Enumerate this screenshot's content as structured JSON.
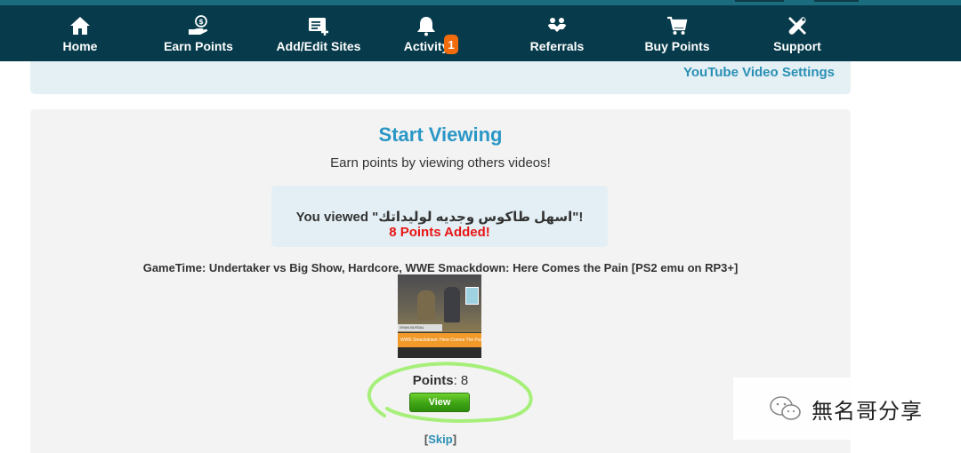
{
  "nav": {
    "items": [
      {
        "label": "Home",
        "icon": "home-icon"
      },
      {
        "label": "Earn Points",
        "icon": "earn-points-icon"
      },
      {
        "label": "Add/Edit Sites",
        "icon": "add-edit-sites-icon"
      },
      {
        "label": "Activity",
        "icon": "bell-icon",
        "badge": "1"
      },
      {
        "label": "Referrals",
        "icon": "referrals-icon"
      },
      {
        "label": "Buy Points",
        "icon": "cart-icon"
      },
      {
        "label": "Support",
        "icon": "support-tools-icon"
      }
    ]
  },
  "settings": {
    "link_label": "YouTube Video Settings"
  },
  "main": {
    "title": "Start Viewing",
    "subtitle": "Earn points by viewing others videos!",
    "notice": {
      "viewed_prefix": "You viewed \"",
      "viewed_video": "اسهل طاكوس وجديه لوليداتك",
      "viewed_suffix": "\"!",
      "points_added": "8 Points Added!"
    },
    "video": {
      "title": "GameTime: Undertaker vs Big Show, Hardcore, WWE Smackdown: Here Comes the Pain [PS2 emu on RP3+]",
      "thumb_banner": "WWE Smackdown: Here Comes The Pain",
      "thumb_strip": "SHAN BLRDAL WRESTLE"
    },
    "points_label": "Points",
    "points_value": ": 8",
    "view_button": "View",
    "skip_open": "[",
    "skip_label": "Skip",
    "skip_close": "]"
  },
  "watermark": {
    "text": "無名哥分享",
    "icon": "wechat-icon"
  },
  "colors": {
    "navbar": "#073b4b",
    "accent": "#2a97c6",
    "badge": "#f26b0c",
    "points_added": "#e81616",
    "view_button": "#3ea414",
    "circle_mark": "#a6f07a"
  }
}
